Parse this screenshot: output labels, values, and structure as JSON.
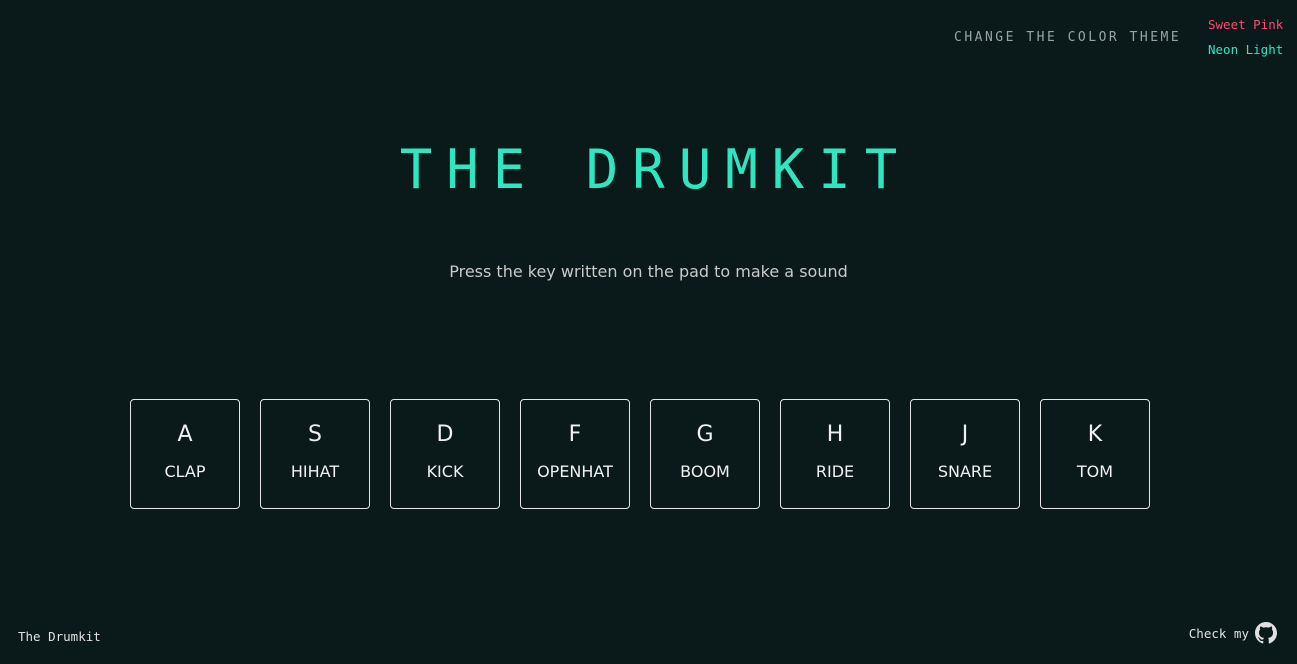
{
  "header": {
    "theme_label": "CHANGE THE COLOR THEME",
    "themes": [
      {
        "label": "Sweet Pink",
        "color": "#ff4a6e"
      },
      {
        "label": "Neon Light",
        "color": "#2ee6c0"
      }
    ]
  },
  "main": {
    "title": "THE DRUMKIT",
    "title_color": "#2ee6c0",
    "subtitle": "Press the key written on the pad to make a sound"
  },
  "pads": [
    {
      "key": "A",
      "sound": "CLAP"
    },
    {
      "key": "S",
      "sound": "HIHAT"
    },
    {
      "key": "D",
      "sound": "KICK"
    },
    {
      "key": "F",
      "sound": "OPENHAT"
    },
    {
      "key": "G",
      "sound": "BOOM"
    },
    {
      "key": "H",
      "sound": "RIDE"
    },
    {
      "key": "J",
      "sound": "SNARE"
    },
    {
      "key": "K",
      "sound": "TOM"
    }
  ],
  "footer": {
    "left_text": "The Drumkit",
    "right_text": "Check my",
    "right_icon": "github-icon"
  },
  "colors": {
    "background": "#0a1a1a",
    "pad_border": "#e6e6e6"
  }
}
